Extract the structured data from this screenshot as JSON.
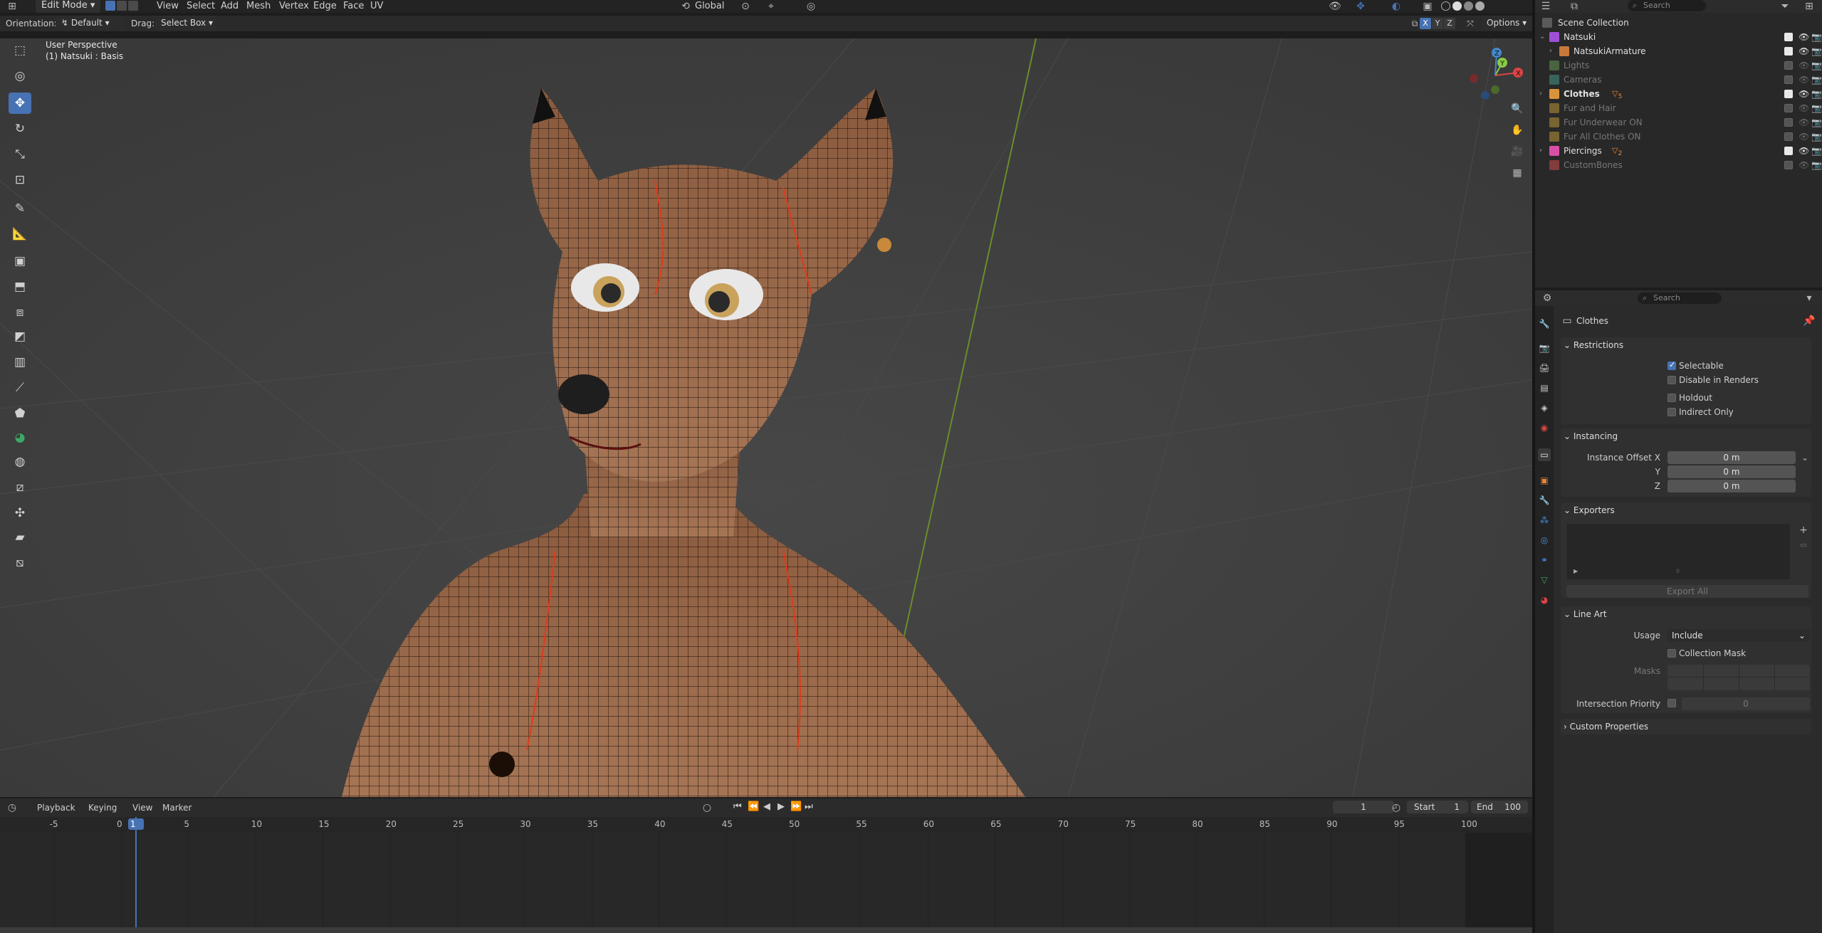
{
  "header": {
    "mode": "Edit Mode",
    "menus": [
      "View",
      "Select",
      "Add",
      "Mesh",
      "Vertex",
      "Edge",
      "Face",
      "UV"
    ],
    "transform_orientation": "Global",
    "search_placeholder": "Search"
  },
  "tool_settings": {
    "orientation_label": "Orientation:",
    "orientation_value": "Default",
    "drag_label": "Drag:",
    "drag_value": "Select Box",
    "axes": [
      "X",
      "Y",
      "Z"
    ],
    "options_label": "Options"
  },
  "viewport": {
    "perspective": "User Perspective",
    "object_info": "(1) Natsuki : Basis",
    "gizmo_axes": [
      "X",
      "Y",
      "Z"
    ]
  },
  "timeline": {
    "menus": [
      "Playback",
      "Keying",
      "View",
      "Marker"
    ],
    "current_frame": "1",
    "start_label": "Start",
    "start_value": "1",
    "end_label": "End",
    "end_value": "100",
    "ruler_ticks": [
      "-5",
      "0",
      "1",
      "5",
      "10",
      "15",
      "20",
      "25",
      "30",
      "35",
      "40",
      "45",
      "50",
      "55",
      "60",
      "65",
      "70",
      "75",
      "80",
      "85",
      "90",
      "95",
      "100"
    ]
  },
  "outliner": {
    "search_placeholder": "Search",
    "root": "Scene Collection",
    "rows": [
      {
        "name": "Natsuki",
        "type": "collection",
        "color": "#a04fd9",
        "enabled": true
      },
      {
        "name": "NatsukiArmature",
        "type": "armature",
        "color": "#c8793a",
        "enabled": true
      },
      {
        "name": "Lights",
        "type": "collection",
        "color": "#6a9e5a",
        "enabled": false
      },
      {
        "name": "Cameras",
        "type": "collection",
        "color": "#4aa090",
        "enabled": false
      },
      {
        "name": "Clothes",
        "type": "collection",
        "color": "#d9943a",
        "enabled": true,
        "badge": "5"
      },
      {
        "name": "Fur and Hair",
        "type": "collection",
        "color": "#c8a03a",
        "enabled": false
      },
      {
        "name": "Fur Underwear ON",
        "type": "collection",
        "color": "#c8a03a",
        "enabled": false
      },
      {
        "name": "Fur All Clothes ON",
        "type": "collection",
        "color": "#c8a03a",
        "enabled": false
      },
      {
        "name": "Piercings",
        "type": "collection",
        "color": "#d94fa8",
        "enabled": true,
        "badge": "2"
      },
      {
        "name": "CustomBones",
        "type": "collection",
        "color": "#d94f4f",
        "enabled": false
      }
    ]
  },
  "properties": {
    "search_placeholder": "Search",
    "title": "Clothes",
    "restrictions": {
      "label": "Restrictions",
      "selectable": "Selectable",
      "disable_in_renders": "Disable in Renders",
      "holdout": "Holdout",
      "indirect_only": "Indirect Only"
    },
    "instancing": {
      "label": "Instancing",
      "offset_x_label": "Instance Offset X",
      "y_label": "Y",
      "z_label": "Z",
      "x": "0 m",
      "y": "0 m",
      "z": "0 m"
    },
    "exporters": {
      "label": "Exporters",
      "export_all": "Export All"
    },
    "line_art": {
      "label": "Line Art",
      "usage_label": "Usage",
      "usage_value": "Include",
      "collection_mask": "Collection Mask",
      "masks_label": "Masks",
      "intersection_priority_label": "Intersection Priority",
      "intersection_priority_value": "0"
    },
    "custom_properties": "Custom Properties"
  }
}
